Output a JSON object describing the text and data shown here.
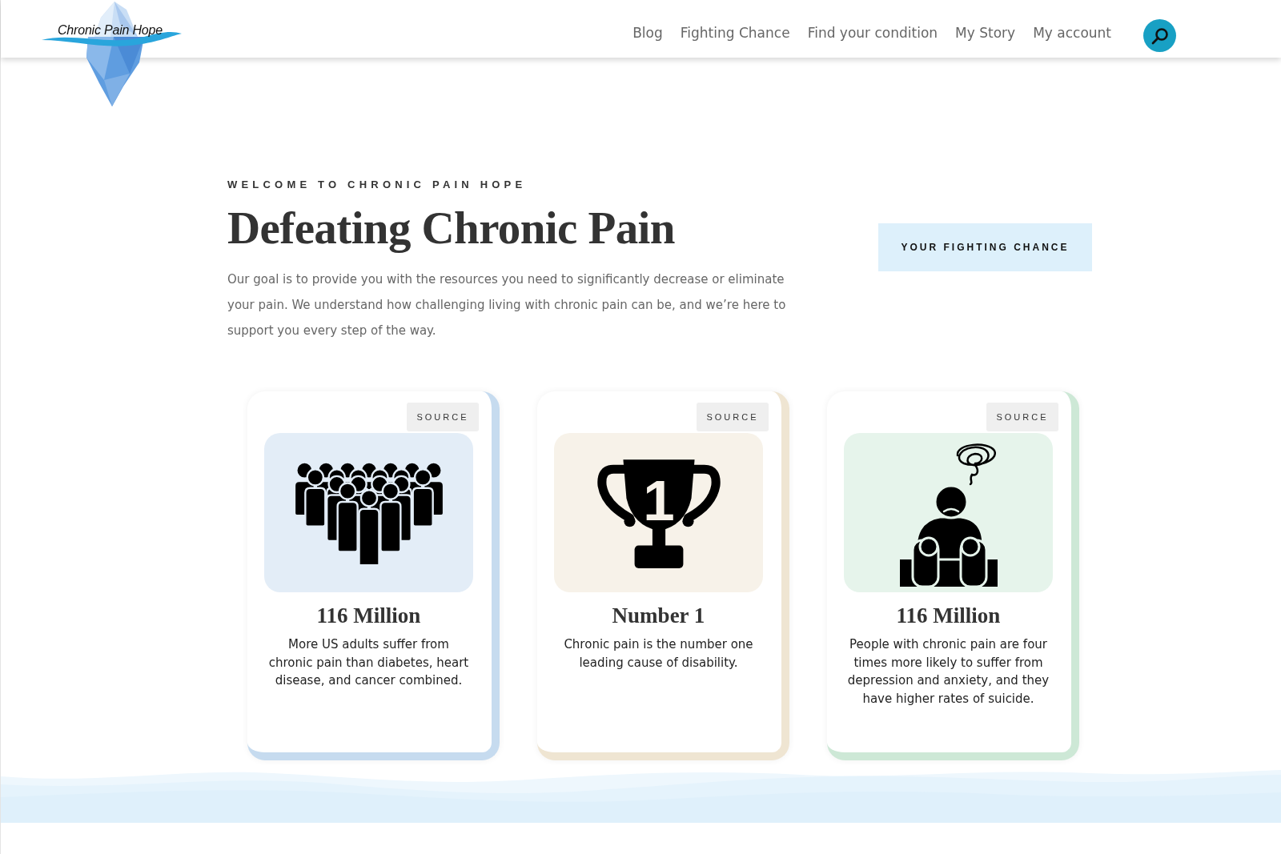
{
  "header": {
    "logo_text": "Chronic Pain Hope",
    "nav": [
      "Blog",
      "Fighting Chance",
      "Find your condition",
      "My Story",
      "My account"
    ]
  },
  "hero": {
    "eyebrow": "WELCOME TO CHRONIC PAIN HOPE",
    "title": "Defeating Chronic Pain",
    "text": "Our goal is to provide you with the resources you need to significantly decrease or eliminate your pain. We understand how challenging living with chronic pain can be, and we’re here to support you every step of the way.",
    "button": "YOUR FIGHTING CHANCE"
  },
  "cards": [
    {
      "source": "SOURCE",
      "color": "#c6dbef",
      "title": "116 Million",
      "text": "More US adults suffer from chronic pain than diabetes, heart disease, and cancer combined."
    },
    {
      "source": "SOURCE",
      "color": "#efe5d2",
      "icon_number": "1",
      "title": "Number 1",
      "text": "Chronic pain is the number one leading cause of disability."
    },
    {
      "source": "SOURCE",
      "color": "#cde8d6",
      "title": "116 Million",
      "text": "People with chronic pain are four times more likely to suffer from depression and anxiety, and they have higher rates of suicide."
    }
  ]
}
